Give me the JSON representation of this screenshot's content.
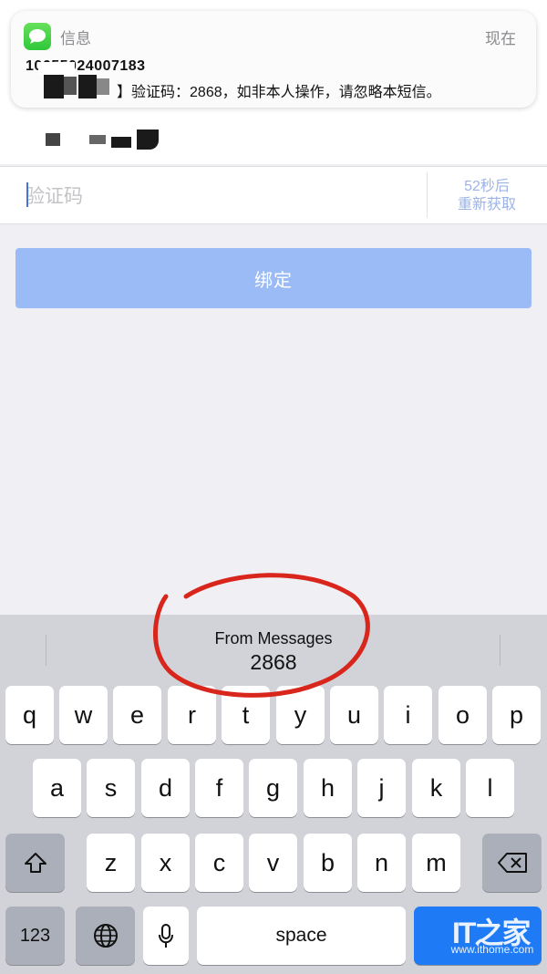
{
  "notification": {
    "app_name": "信息",
    "time": "现在",
    "sender": "10655024007183",
    "body_prefix": "】",
    "body": "验证码：2868，如非本人操作，请忽略本短信。"
  },
  "form": {
    "code_placeholder": "验证码",
    "resend_countdown": "52秒后",
    "resend_label": "重新获取",
    "submit_label": "绑定"
  },
  "keyboard": {
    "suggestion_source": "From Messages",
    "suggestion_code": "2868",
    "row1": [
      "q",
      "w",
      "e",
      "r",
      "t",
      "y",
      "u",
      "i",
      "o",
      "p"
    ],
    "row2": [
      "a",
      "s",
      "d",
      "f",
      "g",
      "h",
      "j",
      "k",
      "l"
    ],
    "row3": [
      "z",
      "x",
      "c",
      "v",
      "b",
      "n",
      "m"
    ],
    "numbers_key": "123",
    "space_key": "space",
    "shift_icon": "shift-arrow-icon",
    "delete_icon": "backspace-icon",
    "globe_icon": "globe-icon",
    "mic_icon": "microphone-icon",
    "return_key_color": "#1f7af5"
  },
  "watermark": {
    "logo": "IT之家",
    "url": "www.ithome.com"
  },
  "colors": {
    "submit_button": "#9abbf5",
    "resend_text": "#9db3e6",
    "highlight_circle": "#d9261c",
    "messages_icon": "#34c759"
  }
}
